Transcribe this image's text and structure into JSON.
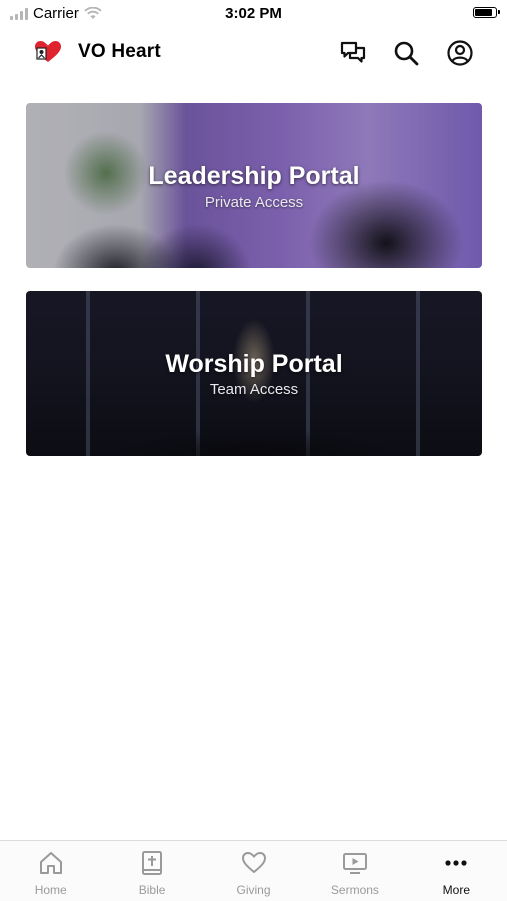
{
  "status_bar": {
    "carrier": "Carrier",
    "time": "3:02 PM"
  },
  "header": {
    "title": "VO Heart",
    "icons": [
      "chat-icon",
      "search-icon",
      "account-icon"
    ]
  },
  "cards": [
    {
      "title": "Leadership Portal",
      "subtitle": "Private Access"
    },
    {
      "title": "Worship Portal",
      "subtitle": "Team Access"
    }
  ],
  "tabs": [
    {
      "label": "Home",
      "icon": "home-icon"
    },
    {
      "label": "Bible",
      "icon": "bible-icon"
    },
    {
      "label": "Giving",
      "icon": "heart-icon"
    },
    {
      "label": "Sermons",
      "icon": "sermons-icon"
    },
    {
      "label": "More",
      "icon": "more-icon",
      "active": true
    }
  ],
  "colors": {
    "brand_red": "#e0242f",
    "inactive": "#9a9a9a",
    "active": "#111111"
  }
}
